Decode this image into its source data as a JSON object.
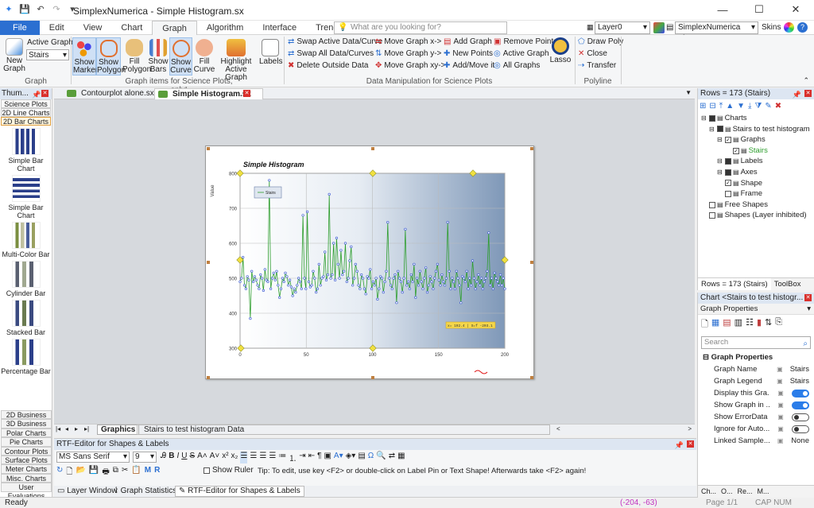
{
  "app": {
    "title": "SimplexNumerica - Simple Histogram.sx",
    "minimize": "—",
    "maximize": "☐",
    "close": "✕"
  },
  "ribbon_tabs": [
    "File",
    "Edit",
    "View",
    "Chart",
    "Graph",
    "Algorithm",
    "Interface",
    "Trend",
    "Custom"
  ],
  "ribbon_active_tab": "Graph",
  "search": {
    "placeholder": "What are you looking for?"
  },
  "layer": {
    "value": "Layer0"
  },
  "theme": {
    "value": "SimplexNumerica Theme"
  },
  "skins_label": "Skins",
  "ribbon": {
    "new_graph": "New Graph",
    "active_graph_label": "Active Graph:",
    "active_graph_value": "Stairs",
    "group_graph": "Graph",
    "show_marker": "Show Marker",
    "show_polygon": "Show Polygon",
    "fill_polygon": "Fill Polygon",
    "show_bars": "Show Bars",
    "show_curve": "Show Curve",
    "fill_curve": "Fill Curve",
    "highlight_active_graph": "Highlight Active Graph",
    "labels": "Labels",
    "group_graph_items": "Graph items for Science Plots, only!",
    "swap_active": "Swap Active Data/Curve",
    "swap_all": "Swap All Data/Curves",
    "delete_outside": "Delete Outside Data",
    "move_x": "Move Graph x->",
    "move_y": "Move Graph y->",
    "move_xy": "Move Graph xy->",
    "add_graph": "Add Graph",
    "new_points": "New Points",
    "add_move": "Add/Move it",
    "remove_points": "Remove Points",
    "active_graph": "Active Graph",
    "all_graphs": "All Graphs",
    "lasso": "Lasso",
    "group_data": "Data Manipulation for Science Plots",
    "draw_poly": "Draw Poly",
    "close_poly": "Close",
    "transfer": "Transfer",
    "group_polyline": "Polyline"
  },
  "doc_tabs": [
    "Contourplot alone.sx",
    "Simple Histogram.sx"
  ],
  "left_panel": {
    "title": "Thum...",
    "categories_top": [
      "Science Plots",
      "2D Line Charts",
      "2D Bar Charts"
    ],
    "thumbs": [
      "Simple Bar Chart",
      "Simple Bar Chart",
      "Multi-Color Bar",
      "Cylinder Bar",
      "Stacked Bar",
      "Percentage Bar"
    ],
    "categories_bottom": [
      "2D Business",
      "3D Business",
      "Polar Charts",
      "Pie Charts",
      "Contour Plots",
      "Surface Plots",
      "Meter Charts",
      "Misc. Charts",
      "User Evaluations"
    ]
  },
  "chart_data": {
    "type": "line",
    "title": "Simple Histogram",
    "xlabel": "",
    "ylabel": "Value",
    "legend": "Stairs",
    "xlim": [
      0,
      200
    ],
    "ylim": [
      300,
      800
    ],
    "xticks": [
      "0",
      "50",
      "100",
      "150",
      "200"
    ],
    "yticks": [
      "300",
      "400",
      "500",
      "600",
      "700",
      "800"
    ],
    "series": [
      {
        "name": "Stairs",
        "color": "#2e9e2e",
        "values": [
          490,
          500,
          560,
          480,
          470,
          505,
          495,
          385,
          520,
          490,
          505,
          495,
          480,
          470,
          510,
          500,
          465,
          525,
          495,
          490,
          780,
          470,
          500,
          515,
          495,
          520,
          480,
          445,
          470,
          500,
          490,
          515,
          505,
          480,
          495,
          475,
          450,
          470,
          460,
          480,
          500,
          490,
          470,
          680,
          500,
          470,
          690,
          490,
          475,
          480,
          520,
          500,
          460,
          470,
          540,
          480,
          500,
          505,
          575,
          495,
          510,
          740,
          500,
          510,
          600,
          495,
          615,
          540,
          500,
          580,
          510,
          520,
          600,
          490,
          500,
          550,
          590,
          480,
          500,
          540,
          520,
          480,
          470,
          510,
          500,
          470,
          455,
          505,
          500,
          525,
          470,
          490,
          480,
          500,
          440,
          470,
          505,
          500,
          460,
          490,
          520,
          660,
          500,
          480,
          470,
          500,
          510,
          430,
          520,
          500,
          490,
          460,
          500,
          640,
          480,
          490,
          470,
          510,
          490,
          540,
          445,
          500,
          480,
          520,
          490,
          470,
          500,
          530,
          460,
          480,
          505,
          490,
          470,
          500,
          520,
          540,
          495,
          480,
          510,
          490,
          480,
          500,
          660,
          520,
          470,
          500,
          490,
          470,
          520,
          500,
          480,
          430,
          505,
          500,
          490,
          520,
          470,
          500,
          480,
          550,
          500,
          470,
          490,
          510,
          480,
          500,
          470,
          490,
          500,
          520,
          630,
          480,
          500,
          470,
          515,
          500,
          490,
          480,
          510,
          480,
          500,
          470
        ]
      }
    ],
    "annotation": "x= 192.4 | S=f -203.1"
  },
  "sheet_tabs": [
    "Graphics",
    "Stairs to test histogram Data"
  ],
  "rtf": {
    "title": "RTF-Editor for Shapes & Labels",
    "font": "MS Sans Serif",
    "size": "9",
    "show_ruler": "Show Ruler",
    "tip": "Tip: To edit, use key <F2> or double-click on Label Pin or Text Shape! Afterwards take <F2> again!"
  },
  "bottom_tabs": [
    "Layer Window",
    "Graph Statistics",
    "RTF-Editor for Shapes & Labels"
  ],
  "status": {
    "left": "Ready",
    "coords": "(-204, -63)",
    "page": "Page 1/1",
    "keys": "CAP NUM SCRL"
  },
  "rows_panel": {
    "title": "Rows = 173 (Stairs)",
    "footer_tab1": "Rows = 173 (Stairs)",
    "footer_tab2": "ToolBox",
    "tree": [
      {
        "label": "Charts",
        "indent": 0
      },
      {
        "label": "Stairs to test histogram",
        "indent": 1
      },
      {
        "label": "Graphs",
        "indent": 2
      },
      {
        "label": "Stairs",
        "indent": 3
      },
      {
        "label": "Labels",
        "indent": 2
      },
      {
        "label": "Axes",
        "indent": 2
      },
      {
        "label": "Shape",
        "indent": 2
      },
      {
        "label": "Frame",
        "indent": 2
      },
      {
        "label": "Free Shapes",
        "indent": 0
      },
      {
        "label": "Shapes (Layer inhibited)",
        "indent": 0
      }
    ]
  },
  "props_panel": {
    "title": "Chart <Stairs to test histogr...",
    "section": "Graph Properties",
    "search_placeholder": "Search",
    "group_title": "Graph Properties",
    "rows": [
      {
        "name": "Graph Name",
        "value": "Stairs",
        "kind": "text"
      },
      {
        "name": "Graph Legend",
        "value": "Stairs",
        "kind": "text"
      },
      {
        "name": "Display this Gra...",
        "value": "on",
        "kind": "toggle"
      },
      {
        "name": "Show Graph in ...",
        "value": "on",
        "kind": "toggle"
      },
      {
        "name": "Show ErrorData",
        "value": "off",
        "kind": "toggle"
      },
      {
        "name": "Ignore for Auto...",
        "value": "off",
        "kind": "toggle"
      },
      {
        "name": "Linked Sample...",
        "value": "None",
        "kind": "text"
      }
    ],
    "footer_tabs": [
      "Ch...",
      "O...",
      "Re...",
      "M..."
    ]
  }
}
